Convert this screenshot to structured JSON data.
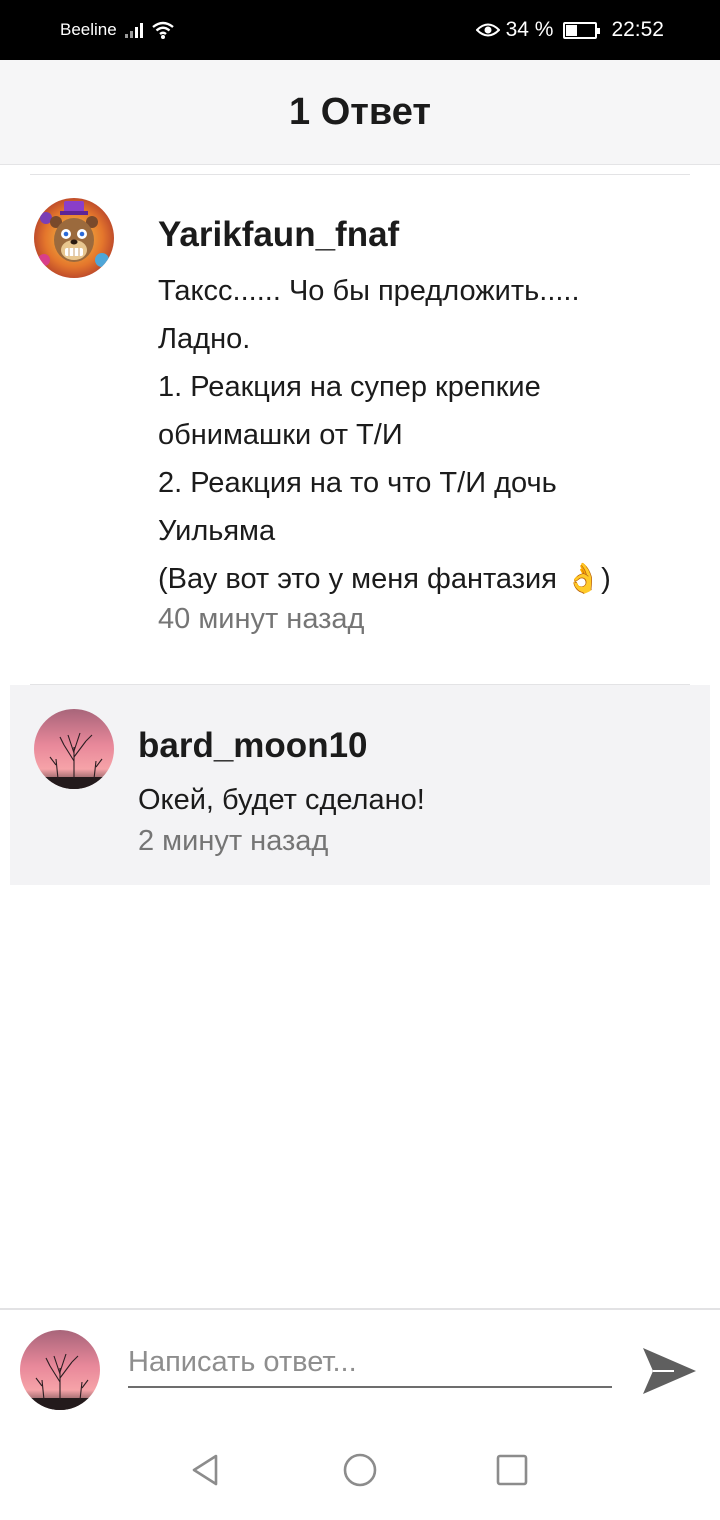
{
  "status_bar": {
    "carrier": "Beeline",
    "battery": "34 %",
    "time": "22:52",
    "icons": [
      "signal-icon",
      "wifi-icon",
      "eye-icon",
      "battery-charging-icon"
    ]
  },
  "header": {
    "title": "1 Ответ"
  },
  "comments": [
    {
      "username": "Yarikfaun_fnaf",
      "lines": [
        "Таксс...... Чо бы предложить.....",
        "Ладно.",
        "1. Реакция на супер крепкие",
        "обнимашки от Т/И",
        "2. Реакция на то что Т/И дочь",
        "Уильяма",
        "(Вау вот это у меня фантазия 👌)"
      ],
      "time": "40 минут назад"
    },
    {
      "username": "bard_moon10",
      "lines": [
        "Окей, будет сделано!"
      ],
      "time": "2 минут назад"
    }
  ],
  "composer": {
    "placeholder": "Написать ответ..."
  },
  "nav": {
    "icons": [
      "back-icon",
      "home-icon",
      "recents-icon"
    ]
  }
}
